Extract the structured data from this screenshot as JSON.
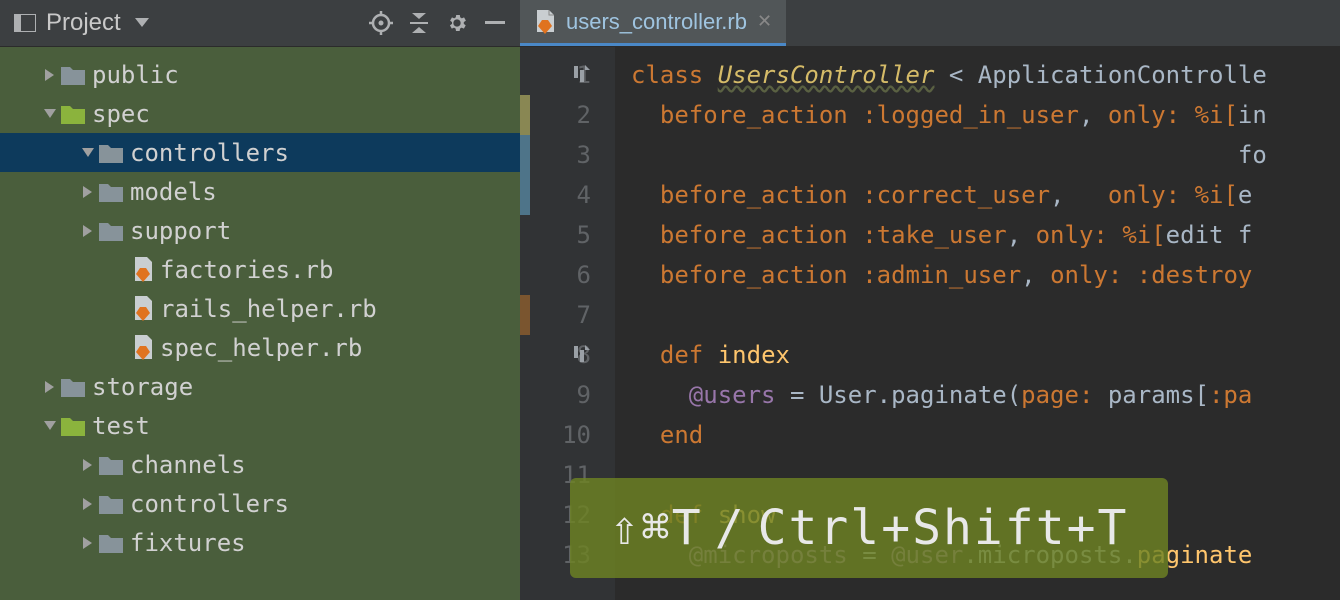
{
  "sidebar": {
    "title": "Project",
    "tree": [
      {
        "indent": 40,
        "arrow": "right",
        "icon": "folder",
        "label": "public"
      },
      {
        "indent": 40,
        "arrow": "down",
        "icon": "folder-green",
        "label": "spec"
      },
      {
        "indent": 78,
        "arrow": "down",
        "icon": "folder",
        "label": "controllers",
        "selected": true
      },
      {
        "indent": 78,
        "arrow": "right",
        "icon": "folder",
        "label": "models"
      },
      {
        "indent": 78,
        "arrow": "right",
        "icon": "folder",
        "label": "support"
      },
      {
        "indent": 112,
        "arrow": "",
        "icon": "ruby",
        "label": "factories.rb"
      },
      {
        "indent": 112,
        "arrow": "",
        "icon": "ruby",
        "label": "rails_helper.rb"
      },
      {
        "indent": 112,
        "arrow": "",
        "icon": "ruby",
        "label": "spec_helper.rb"
      },
      {
        "indent": 40,
        "arrow": "right",
        "icon": "folder",
        "label": "storage"
      },
      {
        "indent": 40,
        "arrow": "down",
        "icon": "folder-green",
        "label": "test"
      },
      {
        "indent": 78,
        "arrow": "right",
        "icon": "folder",
        "label": "channels"
      },
      {
        "indent": 78,
        "arrow": "right",
        "icon": "folder",
        "label": "controllers"
      },
      {
        "indent": 78,
        "arrow": "right",
        "icon": "folder",
        "label": "fixtures"
      }
    ]
  },
  "tab": {
    "filename": "users_controller.rb"
  },
  "code": {
    "lines": [
      {
        "num": "1",
        "html": "<span class='kw'>class</span> <span class='classname'>UsersController</span> &lt; ApplicationControlle"
      },
      {
        "num": "2",
        "html": "  <span class='kw'>before_action</span> <span class='sym'>:logged_in_user</span><span class='punct'>,</span> <span class='sym'>only:</span> <span class='sym'>%i[</span>in"
      },
      {
        "num": "3",
        "html": "                                          fo"
      },
      {
        "num": "4",
        "html": "  <span class='kw'>before_action</span> <span class='sym'>:correct_user</span><span class='punct'>,</span>   <span class='sym'>only:</span> <span class='sym'>%i[</span>e"
      },
      {
        "num": "5",
        "html": "  <span class='kw'>before_action</span> <span class='sym'>:take_user</span><span class='punct'>,</span> <span class='sym'>only:</span> <span class='sym'>%i[</span>edit f"
      },
      {
        "num": "6",
        "html": "  <span class='kw'>before_action</span> <span class='sym'>:admin_user</span><span class='punct'>,</span> <span class='sym'>only:</span> <span class='sym'>:destroy</span>"
      },
      {
        "num": "7",
        "html": " "
      },
      {
        "num": "8",
        "html": "  <span class='kw'>def</span> <span class='method'>index</span>"
      },
      {
        "num": "9",
        "html": "    <span class='attr'>@users</span> = User.paginate(<span class='sym'>page:</span> params[<span class='sym'>:pa</span>"
      },
      {
        "num": "10",
        "html": "  <span class='kw'>end</span>"
      },
      {
        "num": "11",
        "html": " "
      },
      {
        "num": "12",
        "html": "  <span class='kw'>def</span> <span class='method'>show</span>"
      },
      {
        "num": "13",
        "html": "    <span class='attr'>@microposts</span> = <span class='attr'>@user</span>.microposts.<span class='method'>paginate</span>"
      }
    ]
  },
  "shortcut": {
    "mac": "⇧⌘T",
    "sep": "/",
    "win": "Ctrl+Shift+T"
  }
}
